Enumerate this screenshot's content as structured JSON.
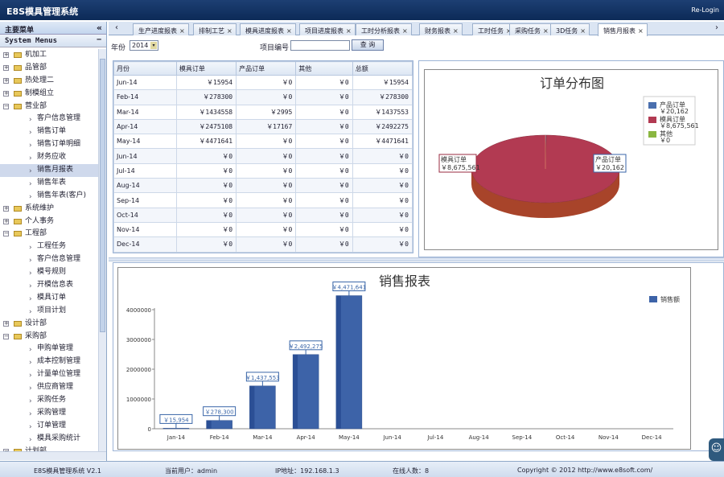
{
  "app": {
    "title": "E8S模具管理系统",
    "relogin": "Re-Login"
  },
  "sidebar": {
    "header": "主要菜单",
    "collapse": "«",
    "sub_header": "System Menus",
    "sub_toggle": "−",
    "items": [
      {
        "label": "机加工",
        "level": 0,
        "exp": "+"
      },
      {
        "label": "品管部",
        "level": 0,
        "exp": "+"
      },
      {
        "label": "热处理二",
        "level": 0,
        "exp": "+"
      },
      {
        "label": "制模组立",
        "level": 0,
        "exp": "+"
      },
      {
        "label": "营业部",
        "level": 0,
        "exp": "−"
      },
      {
        "label": "客户信息管理",
        "level": 1
      },
      {
        "label": "销售订单",
        "level": 1
      },
      {
        "label": "销售订单明细",
        "level": 1
      },
      {
        "label": "财务应收",
        "level": 1
      },
      {
        "label": "销售月报表",
        "level": 1,
        "selected": true
      },
      {
        "label": "销售年表",
        "level": 1
      },
      {
        "label": "销售年表(客户)",
        "level": 1
      },
      {
        "label": "系统维护",
        "level": 0,
        "exp": "+"
      },
      {
        "label": "个人事务",
        "level": 0,
        "exp": "+"
      },
      {
        "label": "工程部",
        "level": 0,
        "exp": "−"
      },
      {
        "label": "工程任务",
        "level": 1
      },
      {
        "label": "客户信息管理",
        "level": 1
      },
      {
        "label": "模号规则",
        "level": 1
      },
      {
        "label": "开模信息表",
        "level": 1
      },
      {
        "label": "模具订单",
        "level": 1
      },
      {
        "label": "项目计划",
        "level": 1
      },
      {
        "label": "设计部",
        "level": 0,
        "exp": "+"
      },
      {
        "label": "采购部",
        "level": 0,
        "exp": "−"
      },
      {
        "label": "申购单管理",
        "level": 1
      },
      {
        "label": "成本控制管理",
        "level": 1
      },
      {
        "label": "计量单位管理",
        "level": 1
      },
      {
        "label": "供应商管理",
        "level": 1
      },
      {
        "label": "采购任务",
        "level": 1
      },
      {
        "label": "采购管理",
        "level": 1
      },
      {
        "label": "订单管理",
        "level": 1
      },
      {
        "label": "模具采购统计",
        "level": 1
      },
      {
        "label": "计划部",
        "level": 0,
        "exp": "−"
      }
    ]
  },
  "tabs": [
    {
      "label": "生产进度报表"
    },
    {
      "label": "排制工艺"
    },
    {
      "label": "模具进度报表"
    },
    {
      "label": "项目进度报表"
    },
    {
      "label": "工时分析报表"
    },
    {
      "label": "财务报表"
    },
    {
      "label": "工时任务"
    },
    {
      "label": "采购任务"
    },
    {
      "label": "3D任务"
    },
    {
      "label": "销售月报表",
      "active": true
    }
  ],
  "tab_nav": {
    "prev": "‹",
    "next": "›"
  },
  "toolbar": {
    "year_label": "年份",
    "year_value": "2014",
    "project_label": "项目编号",
    "project_value": "",
    "query": "查 询"
  },
  "table": {
    "headers": [
      "月份",
      "模具订单",
      "产品订单",
      "其他",
      "总额"
    ],
    "rows": [
      [
        "Jun-14",
        "￥15954",
        "￥0",
        "￥0",
        "￥15954"
      ],
      [
        "Feb-14",
        "￥278300",
        "￥0",
        "￥0",
        "￥278300"
      ],
      [
        "Mar-14",
        "￥1434558",
        "￥2995",
        "￥0",
        "￥1437553"
      ],
      [
        "Apr-14",
        "￥2475108",
        "￥17167",
        "￥0",
        "￥2492275"
      ],
      [
        "May-14",
        "￥4471641",
        "￥0",
        "￥0",
        "￥4471641"
      ],
      [
        "Jun-14",
        "￥0",
        "￥0",
        "￥0",
        "￥0"
      ],
      [
        "Jul-14",
        "￥0",
        "￥0",
        "￥0",
        "￥0"
      ],
      [
        "Aug-14",
        "￥0",
        "￥0",
        "￥0",
        "￥0"
      ],
      [
        "Sep-14",
        "￥0",
        "￥0",
        "￥0",
        "￥0"
      ],
      [
        "Oct-14",
        "￥0",
        "￥0",
        "￥0",
        "￥0"
      ],
      [
        "Nov-14",
        "￥0",
        "￥0",
        "￥0",
        "￥0"
      ],
      [
        "Dec-14",
        "￥0",
        "￥0",
        "￥0",
        "￥0"
      ]
    ]
  },
  "status": {
    "app": "E8S模具管理系统 V2.1",
    "user": "当前用户：admin",
    "ip": "IP地址：192.168.1.3",
    "online": "在线人数：8",
    "copyright": "Copyright © 2012 http://www.e8soft.com/"
  },
  "chart_data": [
    {
      "type": "pie",
      "title": "订单分布图",
      "slices": [
        {
          "name": "产品订单",
          "value": 20162,
          "label": "￥20,162",
          "color": "#4a6fae"
        },
        {
          "name": "模具订单",
          "value": 8675561,
          "label": "￥8,675,561",
          "color": "#b23a52"
        },
        {
          "name": "其他",
          "value": 0,
          "label": "￥0",
          "color": "#8ab640"
        }
      ],
      "callouts": [
        {
          "text": "模具订单",
          "value": "￥8,675,561"
        },
        {
          "text": "产品订单",
          "value": "￥20,162"
        }
      ],
      "legend": "right"
    },
    {
      "type": "bar",
      "title": "销售报表",
      "categories": [
        "Jan-14",
        "Feb-14",
        "Mar-14",
        "Apr-14",
        "May-14",
        "Jun-14",
        "Jul-14",
        "Aug-14",
        "Sep-14",
        "Oct-14",
        "Nov-14",
        "Dec-14"
      ],
      "series": [
        {
          "name": "销售额",
          "values": [
            15954,
            278300,
            1437553,
            2492275,
            4471641,
            0,
            0,
            0,
            0,
            0,
            0,
            0
          ],
          "color": "#3d63a8"
        }
      ],
      "data_labels": [
        "￥15,954",
        "￥278,300",
        "￥1,437,553",
        "￥2,492,275",
        "￥4,471,641"
      ],
      "yticks": [
        0,
        1000000,
        2000000,
        3000000,
        4000000
      ],
      "ytick_labels": [
        "0",
        "1000000",
        "2000000",
        "3000000",
        "4000000"
      ],
      "ylim": [
        0,
        5000000
      ],
      "legend": "top-right",
      "grid": false
    }
  ]
}
